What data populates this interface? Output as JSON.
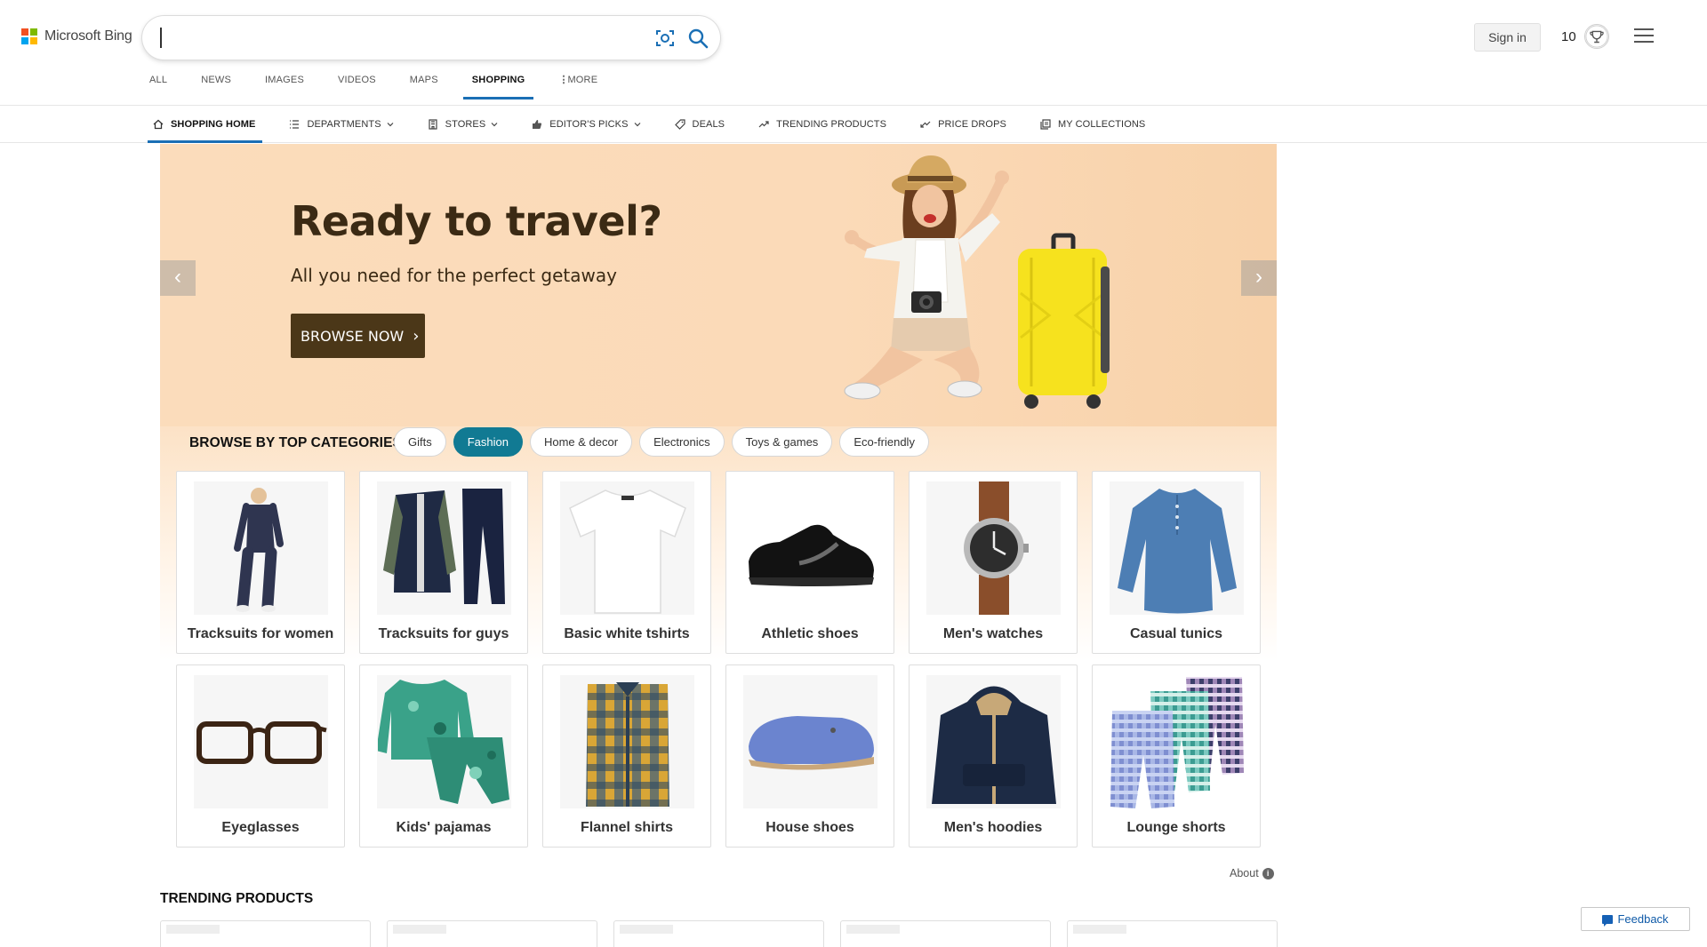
{
  "header": {
    "logo_text": "Microsoft Bing",
    "search": {
      "value": "",
      "placeholder": ""
    },
    "signin_label": "Sign in",
    "rewards_count": "10"
  },
  "scope_tabs": [
    {
      "label": "ALL",
      "active": false
    },
    {
      "label": "NEWS",
      "active": false
    },
    {
      "label": "IMAGES",
      "active": false
    },
    {
      "label": "VIDEOS",
      "active": false
    },
    {
      "label": "MAPS",
      "active": false
    },
    {
      "label": "SHOPPING",
      "active": true
    },
    {
      "label": "MORE",
      "active": false
    }
  ],
  "shopping_nav": [
    {
      "label": "SHOPPING HOME",
      "icon": "home-icon",
      "active": true,
      "dropdown": false
    },
    {
      "label": "DEPARTMENTS",
      "icon": "list-icon",
      "active": false,
      "dropdown": true
    },
    {
      "label": "STORES",
      "icon": "store-icon",
      "active": false,
      "dropdown": true
    },
    {
      "label": "EDITOR'S PICKS",
      "icon": "thumbs-up-icon",
      "active": false,
      "dropdown": true
    },
    {
      "label": "DEALS",
      "icon": "tag-icon",
      "active": false,
      "dropdown": false
    },
    {
      "label": "TRENDING PRODUCTS",
      "icon": "trending-up-icon",
      "active": false,
      "dropdown": false
    },
    {
      "label": "PRICE DROPS",
      "icon": "trending-down-icon",
      "active": false,
      "dropdown": false
    },
    {
      "label": "MY COLLECTIONS",
      "icon": "collections-icon",
      "active": false,
      "dropdown": false
    }
  ],
  "hero": {
    "title": "Ready to travel?",
    "subtitle": "All you need for the perfect getaway",
    "button_label": "BROWSE NOW",
    "background_color": "#fbdcbb",
    "button_color": "#4b3718"
  },
  "categories": {
    "title": "BROWSE BY TOP CATEGORIES",
    "chips": [
      {
        "label": "Gifts",
        "active": false
      },
      {
        "label": "Fashion",
        "active": true
      },
      {
        "label": "Home & decor",
        "active": false
      },
      {
        "label": "Electronics",
        "active": false
      },
      {
        "label": "Toys & games",
        "active": false
      },
      {
        "label": "Eco-friendly",
        "active": false
      }
    ],
    "accent_color": "#117a93",
    "items": [
      {
        "label": "Tracksuits for women",
        "icon": "tracksuit-women-image"
      },
      {
        "label": "Tracksuits for guys",
        "icon": "tracksuit-men-image"
      },
      {
        "label": "Basic white tshirts",
        "icon": "tshirt-image"
      },
      {
        "label": "Athletic shoes",
        "icon": "sneaker-image"
      },
      {
        "label": "Men's watches",
        "icon": "watch-image"
      },
      {
        "label": "Casual tunics",
        "icon": "tunic-image"
      },
      {
        "label": "Eyeglasses",
        "icon": "eyeglasses-image"
      },
      {
        "label": "Kids' pajamas",
        "icon": "pajamas-image"
      },
      {
        "label": "Flannel shirts",
        "icon": "flannel-shirt-image"
      },
      {
        "label": "House shoes",
        "icon": "slipper-image"
      },
      {
        "label": "Men's hoodies",
        "icon": "hoodie-image"
      },
      {
        "label": "Lounge shorts",
        "icon": "shorts-image"
      }
    ]
  },
  "about_label": "About",
  "trending": {
    "title": "TRENDING PRODUCTS"
  },
  "feedback_label": "Feedback"
}
